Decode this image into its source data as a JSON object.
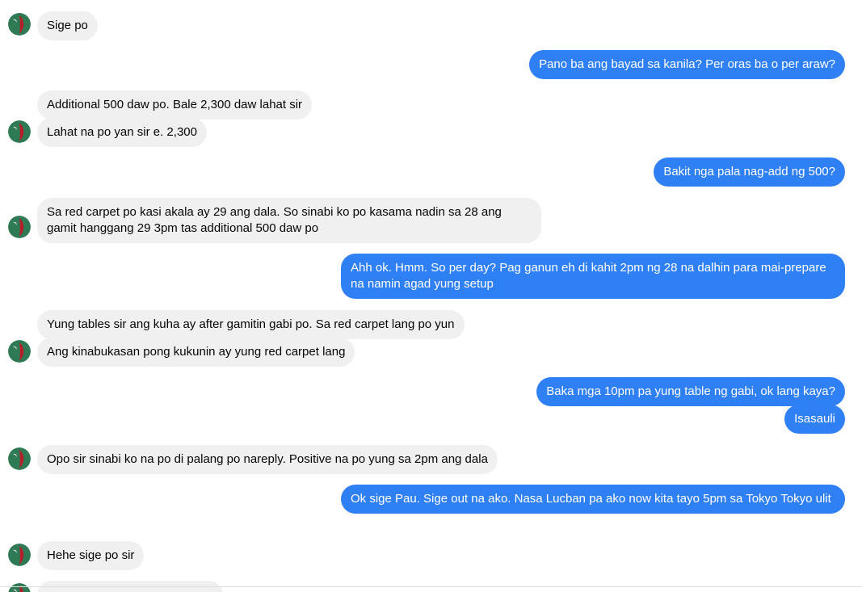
{
  "conversation": {
    "messages": [
      {
        "sender": "contact",
        "text": "Sige po"
      },
      {
        "sender": "me",
        "text": "Pano ba ang bayad sa kanila? Per oras ba o per araw?"
      },
      {
        "sender": "contact",
        "text": "Additional 500 daw po. Bale 2,300 daw lahat sir"
      },
      {
        "sender": "contact",
        "text": "Lahat na po yan sir e. 2,300"
      },
      {
        "sender": "me",
        "text": "Bakit nga pala nag-add ng 500?"
      },
      {
        "sender": "contact",
        "text": "Sa red carpet po kasi akala ay 29 ang dala. So sinabi ko po kasama nadin sa 28 ang gamit hanggang 29 3pm tas additional 500 daw po"
      },
      {
        "sender": "me",
        "text": "Ahh ok. Hmm. So per day? Pag ganun eh di kahit 2pm ng 28 na dalhin para mai-prepare na namin agad yung setup"
      },
      {
        "sender": "contact",
        "text": "Yung tables sir ang kuha ay after gamitin gabi po. Sa red carpet lang po yun"
      },
      {
        "sender": "contact",
        "text": "Ang kinabukasan pong kukunin ay yung red carpet lang"
      },
      {
        "sender": "me",
        "text": "Baka mga 10pm pa yung table ng gabi, ok lang kaya?"
      },
      {
        "sender": "me",
        "text": "Isasauli"
      },
      {
        "sender": "contact",
        "text": "Opo sir sinabi ko na po di palang po nareply. Positive na po yung sa 2pm ang dala"
      },
      {
        "sender": "me",
        "text": "Ok sige Pau. Sige out na ako. Nasa Lucban pa ako now kita tayo 5pm sa Tokyo Tokyo ulit"
      },
      {
        "sender": "contact",
        "text": "Hehe sige po sir"
      }
    ],
    "colors": {
      "incoming_bg": "#f0f0f0",
      "incoming_text": "#050505",
      "outgoing_bg": "#2f7ff5",
      "outgoing_text": "#ffffff"
    },
    "avatar_icon": "contact-avatar-icon"
  }
}
